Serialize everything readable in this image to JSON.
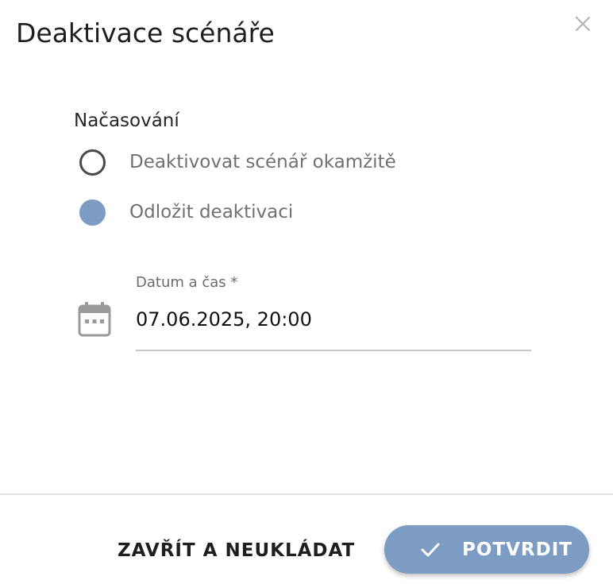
{
  "dialog": {
    "title": "Deaktivace scénáře",
    "close_icon": "close-icon"
  },
  "timing": {
    "label": "Načasování",
    "options": [
      {
        "label": "Deaktivovat scénář okamžitě",
        "selected": false
      },
      {
        "label": "Odložit deaktivaci",
        "selected": true
      }
    ]
  },
  "datetime_field": {
    "label": "Datum a čas *",
    "value": "07.06.2025, 20:00",
    "icon": "calendar-icon"
  },
  "footer": {
    "cancel_label": "ZAVŘÍT A NEUKLÁDAT",
    "confirm_label": "POTVRDIT",
    "confirm_icon": "check-icon"
  },
  "colors": {
    "accent": "#7c9cc4",
    "radio_border": "#4a4a4a",
    "muted_text": "#707070"
  }
}
